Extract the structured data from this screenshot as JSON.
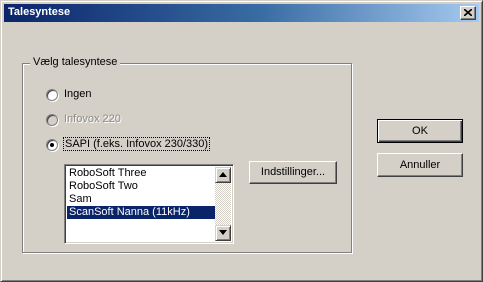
{
  "window": {
    "title": "Talesyntese"
  },
  "group": {
    "legend": "Vælg talesyntese",
    "options": [
      {
        "label": "Ingen",
        "selected": false,
        "disabled": false
      },
      {
        "label": "Infovox 220",
        "selected": false,
        "disabled": true
      },
      {
        "label": "SAPI (f.eks. Infovox 230/330)",
        "selected": true,
        "disabled": false
      }
    ]
  },
  "voices": {
    "items": [
      "RoboSoft Three",
      "RoboSoft Two",
      "Sam",
      "ScanSoft Nanna (11kHz)"
    ],
    "selected_index": 3
  },
  "buttons": {
    "settings": "Indstillinger...",
    "ok": "OK",
    "cancel": "Annuller"
  },
  "icons": {
    "close": "close-icon",
    "scroll_up": "arrow-up-icon",
    "scroll_down": "arrow-down-icon"
  },
  "colors": {
    "title_bar": "#0a246a",
    "selection": "#0a246a",
    "face": "#d4d0c8"
  }
}
